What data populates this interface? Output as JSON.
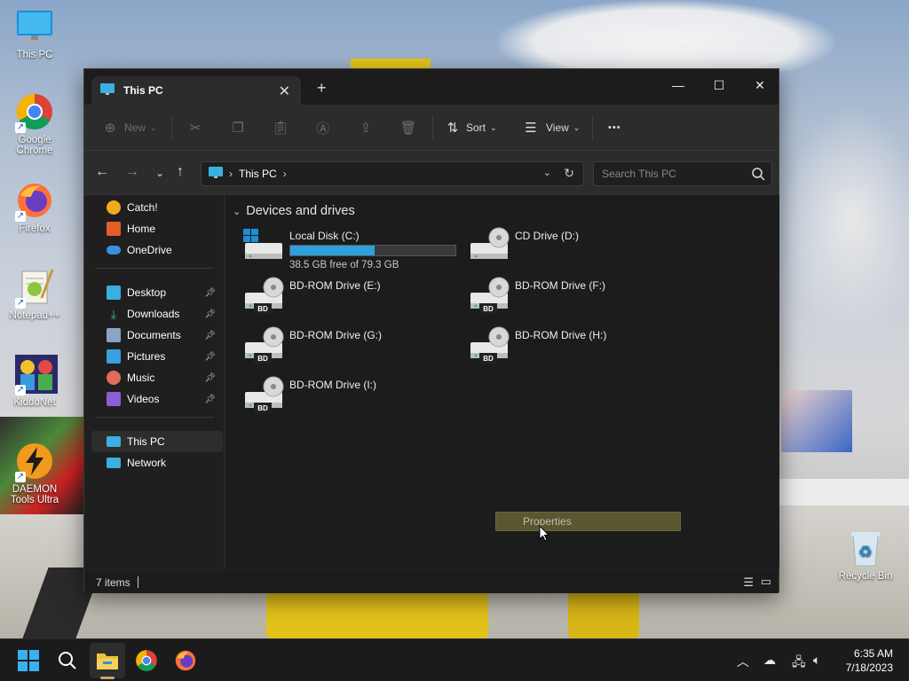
{
  "desktop": {
    "icons": [
      {
        "label": "This PC",
        "icon": "monitor-icon"
      },
      {
        "label": "Google Chrome",
        "icon": "chrome-icon"
      },
      {
        "label": "Firefox",
        "icon": "firefox-icon"
      },
      {
        "label": "Notepad++",
        "icon": "notepadpp-icon"
      },
      {
        "label": "KiddoNet",
        "icon": "kiddonet-icon"
      },
      {
        "label": "DAEMON Tools Ultra",
        "icon": "daemon-tools-icon"
      }
    ],
    "recycle_bin": "Recycle Bin"
  },
  "window": {
    "tab_title": "This PC",
    "new_tab_symbol": "+",
    "controls": {
      "minimize": "—",
      "maximize": "☐",
      "close": "✕"
    }
  },
  "toolbar": {
    "new_label": "New",
    "sort_label": "Sort",
    "view_label": "View",
    "more_label": "•••"
  },
  "address": {
    "path": "This PC",
    "search_placeholder": "Search This PC"
  },
  "sidebar": {
    "items": [
      {
        "label": "Catch!",
        "icon": "catch-icon",
        "color": "#f2a91d"
      },
      {
        "label": "Home",
        "icon": "home-icon",
        "color": "#e45d2b"
      },
      {
        "label": "OneDrive",
        "icon": "onedrive-icon",
        "color": "#3b8fe0"
      },
      {
        "label": "Desktop",
        "icon": "desktop-icon",
        "color": "#3ab0e2",
        "pinned": true
      },
      {
        "label": "Downloads",
        "icon": "downloads-icon",
        "color": "#3bbf6c",
        "pinned": true
      },
      {
        "label": "Documents",
        "icon": "documents-icon",
        "color": "#8aa4c4",
        "pinned": true
      },
      {
        "label": "Pictures",
        "icon": "pictures-icon",
        "color": "#3aa0e0",
        "pinned": true
      },
      {
        "label": "Music",
        "icon": "music-icon",
        "color": "#e06c5a",
        "pinned": true
      },
      {
        "label": "Videos",
        "icon": "videos-icon",
        "color": "#8a5fd6",
        "pinned": true
      },
      {
        "label": "This PC",
        "icon": "this-pc-icon",
        "color": "#3ab0e2",
        "selected": true
      },
      {
        "label": "Network",
        "icon": "network-icon",
        "color": "#3ab0e2"
      }
    ]
  },
  "content": {
    "group_title": "Devices and drives",
    "drives": [
      {
        "name": "Local Disk (C:)",
        "free_text": "38.5 GB free of 79.3 GB",
        "used_fraction": 0.51,
        "type": "local"
      },
      {
        "name": "CD Drive (D:)",
        "type": "cd"
      },
      {
        "name": "BD-ROM Drive (E:)",
        "type": "bd"
      },
      {
        "name": "BD-ROM Drive (F:)",
        "type": "bd"
      },
      {
        "name": "BD-ROM Drive (G:)",
        "type": "bd"
      },
      {
        "name": "BD-ROM Drive (H:)",
        "type": "bd"
      },
      {
        "name": "BD-ROM Drive (I:)",
        "type": "bd"
      }
    ],
    "bd_badge": "BD",
    "tooltip": "Properties"
  },
  "status": {
    "items_count": "7 items"
  },
  "taskbar": {
    "time": "6:35 AM",
    "date": "7/18/2023"
  },
  "colors": {
    "accent": "#2ea0dc",
    "window_bg": "#202020",
    "tooltip_bg": "#5a5630"
  }
}
